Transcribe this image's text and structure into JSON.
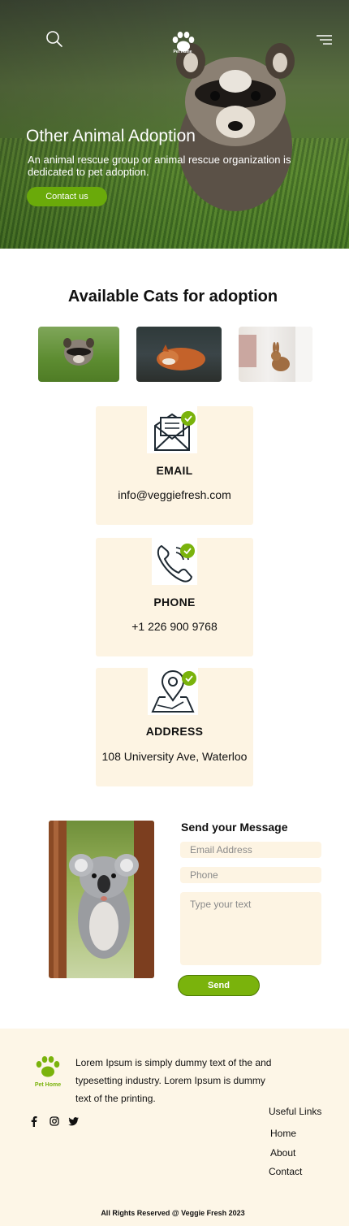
{
  "hero": {
    "title": "Other Animal Adoption",
    "subtitle": "An animal rescue group or animal rescue organization is dedicated to pet adoption.",
    "button_label": "Contact us",
    "logo_text": "Pet Home"
  },
  "gallery": {
    "title": "Available Cats for adoption"
  },
  "contacts": [
    {
      "label": "EMAIL",
      "value": "info@veggiefresh.com",
      "icon": "envelope-icon"
    },
    {
      "label": "PHONE",
      "value": "+1 226 900 9768",
      "icon": "phone-icon"
    },
    {
      "label": "ADDRESS",
      "value": "108 University Ave, Waterloo",
      "icon": "map-pin-icon"
    }
  ],
  "message_form": {
    "title": "Send your Message",
    "email_placeholder": "Email Address",
    "phone_placeholder": "Phone",
    "text_placeholder": "Type your text",
    "send_label": "Send"
  },
  "footer": {
    "logo_text": "Pet Home",
    "description": "Lorem Ipsum is simply dummy text of the and typesetting industry. Lorem Ipsum is dummy text of the printing.",
    "links_title": "Useful Links",
    "links": [
      "Home",
      "About",
      "Contact"
    ],
    "copyright": "All Rights Reserved @ Veggie Fresh 2023"
  },
  "colors": {
    "accent": "#6aaa0a",
    "card_bg": "#fdf4e3",
    "footer_bg": "#fdf6e7"
  }
}
